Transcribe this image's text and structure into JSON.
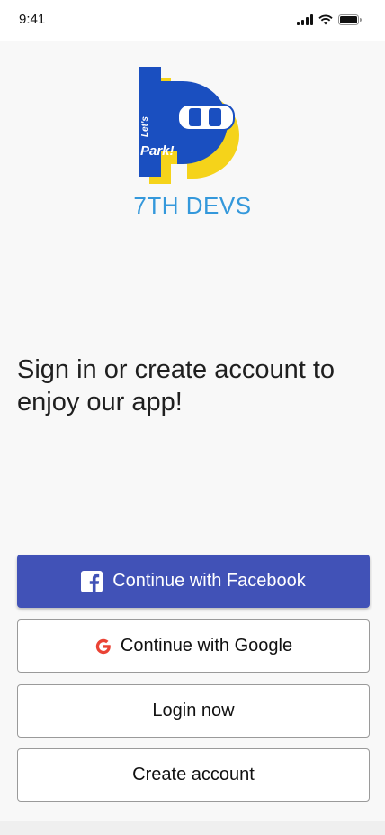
{
  "status_bar": {
    "time": "9:41"
  },
  "logo": {
    "text_lets": "Let's",
    "text_park": "Park!",
    "colors": {
      "blue": "#1a4fc0",
      "yellow": "#f5d31a"
    }
  },
  "brand": {
    "name": "7TH DEVS",
    "color": "#3498db"
  },
  "tagline": "Sign in or create account to enjoy our app!",
  "buttons": {
    "facebook": "Continue with Facebook",
    "google": "Continue with Google",
    "login": "Login now",
    "create": "Create account"
  },
  "colors": {
    "facebook_button": "#4152b7",
    "google_g": "#ea4335"
  }
}
